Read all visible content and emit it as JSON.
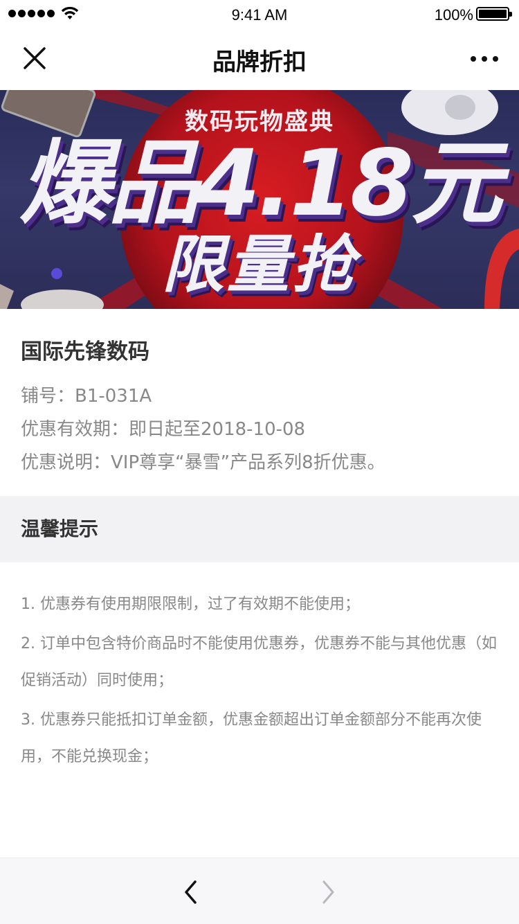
{
  "status_bar": {
    "time": "9:41 AM",
    "battery": "100%",
    "battery_level": 1.0,
    "icons": [
      "signal-dots-icon",
      "wifi-icon",
      "battery-icon"
    ]
  },
  "nav": {
    "title": "品牌折扣",
    "close_icon": "close-icon",
    "more_icon": "more-icon"
  },
  "banner": {
    "subtitle": "数码玩物盛典",
    "headline": "爆品4.18元",
    "tagline": "限量抢",
    "colors": {
      "background": "#2c2d58",
      "circle": "#b3121c",
      "shadow": "#4b2f8a"
    }
  },
  "shop": {
    "name": "国际先锋数码",
    "shop_no": "铺号：B1-031A",
    "valid_period": "优惠有效期：即日起至2018-10-08",
    "description": "优惠说明：VIP尊享“暴雪”产品系列8折优惠。"
  },
  "tips": {
    "title": "温馨提示",
    "items": [
      "1. 优惠券有使用期限限制，过了有效期不能使用；",
      "2. 订单中包含特价商品时不能使用优惠券，优惠券不能与其他优惠（如促销活动）同时使用；",
      "3. 优惠券只能抵扣订单金额，优惠金额超出订单金额部分不能再次使用，不能兑换现金；"
    ]
  },
  "bottom_bar": {
    "back_icon": "chevron-left-icon",
    "forward_icon": "chevron-right-icon"
  },
  "colors": {
    "text_primary": "#333333",
    "text_secondary": "#888888",
    "section_bg": "#f2f2f4"
  }
}
